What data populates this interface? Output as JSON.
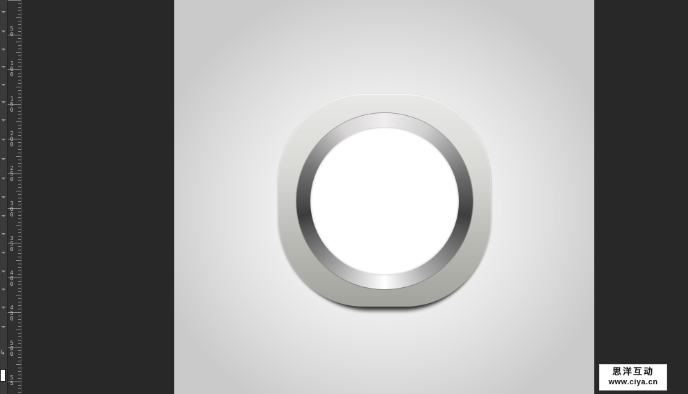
{
  "ruler": {
    "labels": [
      "5 0",
      "1 0 0",
      "1 5 0",
      "2 0 0",
      "2 5 0",
      "3 0 0",
      "3 5 0",
      "4 0 0",
      "4 5 0",
      "5 0 0",
      "5 5"
    ]
  },
  "canvas": {
    "artwork": "metallic-ring-button-icon",
    "colors": {
      "background_center": "#fefefe",
      "background_edge": "#cacaca",
      "icon_top": "#e8e8e6",
      "icon_bottom": "#a3a39d",
      "ring_dark": "#3e3e3e",
      "ring_light": "#f0eeee",
      "inner_fill": "#ffffff"
    }
  },
  "watermark": {
    "chinese": "思洋互动",
    "url": "www.ciya.cn"
  },
  "ui_colors": {
    "workspace": "#282828",
    "ruler": "#2f2f2f"
  }
}
